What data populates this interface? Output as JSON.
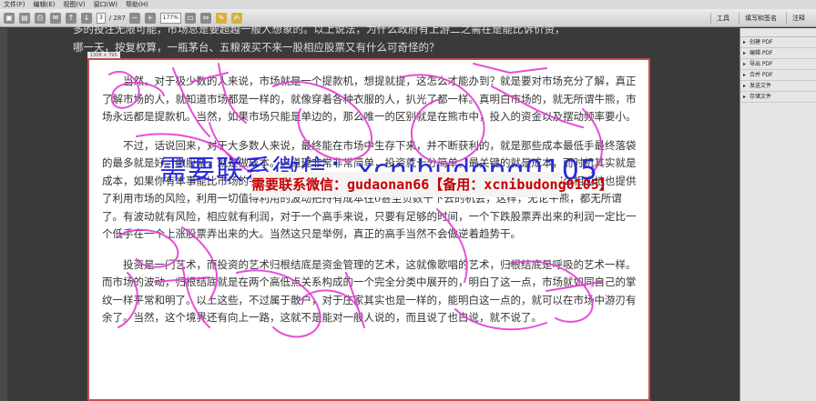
{
  "menubar": {
    "items": [
      "文件(F)",
      "编辑(E)",
      "视图(V)",
      "窗口(W)",
      "帮助(H)"
    ]
  },
  "toolbar": {
    "page_current": "3",
    "page_total": "/ 287",
    "zoom": "177%",
    "right_buttons": [
      "工具",
      "填写和签名",
      "注释"
    ]
  },
  "right_panel": {
    "items": [
      "创建 PDF",
      "编辑 PDF",
      "导出 PDF",
      "合并 PDF",
      "发送文件",
      "存储文件"
    ]
  },
  "above_text": {
    "line1": "多的投注无限可能，市场总是要超越一般人想象的。以上说法，为什么政府有上游二之需在是能比诉价资，",
    "line2": "哪一天，按复权算，一瓶茅台、五粮液买不来一股相应股票又有什么可奇怪的？"
  },
  "page": {
    "size_label": "1308 × 795",
    "paragraphs": [
      "当然，对于极少数的人来说，市场就是一个提款机，想提就提，这怎么才能办到？就是要对市场充分了解，真正了解市场的人，就知道市场都是一样的，就像穿着各种衣服的人，扒光了都一样。真明白市场的，就无所谓牛熊，市场永远都是提款机。当然，如果市场只能是单边的，那么唯一的区别就是在熊市中，投入的资金以及摆动频率要小。",
      "不过，话说回来，对于大多数人来说，最终能在市场中生存下来，并不断获利的，就是那些成本最低手最终落袋的最多就是好。做股票，就是做成本。这道理非常非常简单，投资就十分简单，最关键的就是成本，而时机其实就是成本，如果你有本事能比市场的平均成本要低，就永远立于不败之地。既然波动是市场风险所在，那么相应地也提供了利用市场的风险，利用一切值得利用的波动把持有成本往0甚至负数干下去的机会，这样，无论牛熊，都无所谓了。有波动就有风险，相应就有利润，对于一个高手来说，只要有足够的时间，一个下跌股票弄出来的利润一定比一个低手在一个上涨股票弄出来的大。当然这只是举例，真正的高手当然不会做逆着趋势干。",
      "投资是一门艺术，而投资的艺术归根结底是资金管理的艺术，这就像歌唱的艺术，归根结底是呼吸的艺术一样。而市场的波动，归根结底就是在两个高低点关系构成的一个完全分类中展开的，明白了这一点，市场就如同自己的掌纹一样平常和明了。以上这些，不过属于散户，对于庄家其实也是一样的，能明白这一点的，就可以在市场中游刃有余了。当然，这个境界还有向上一路，这就不是能对一般人说的，而且说了也白说，就不说了。"
    ]
  },
  "watermark": {
    "big": "需要联系微信：xcnibudong0105",
    "banner": "需要联系微信：gudaonan66【备用：xcnibudong0105】"
  }
}
